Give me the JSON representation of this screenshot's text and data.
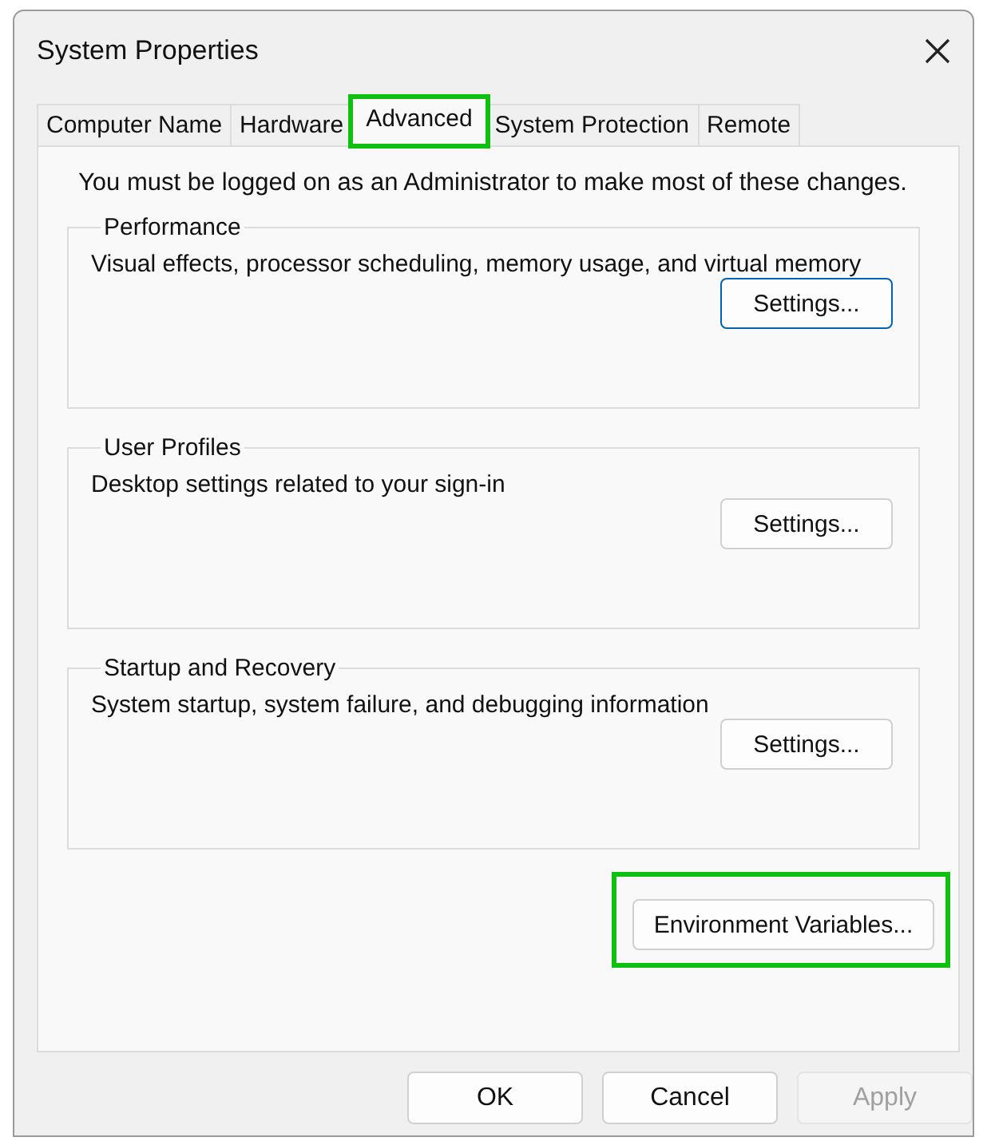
{
  "window": {
    "title": "System Properties"
  },
  "tabs": [
    {
      "label": "Computer Name",
      "selected": false,
      "highlighted": false
    },
    {
      "label": "Hardware",
      "selected": false,
      "highlighted": false
    },
    {
      "label": "Advanced",
      "selected": true,
      "highlighted": true
    },
    {
      "label": "System Protection",
      "selected": false,
      "highlighted": false
    },
    {
      "label": "Remote",
      "selected": false,
      "highlighted": false
    }
  ],
  "notice": "You must be logged on as an Administrator to make most of these changes.",
  "groups": [
    {
      "title": "Performance",
      "description": "Visual effects, processor scheduling, memory usage, and virtual memory",
      "button": "Settings...",
      "focused": true
    },
    {
      "title": "User Profiles",
      "description": "Desktop settings related to your sign-in",
      "button": "Settings...",
      "focused": false
    },
    {
      "title": "Startup and Recovery",
      "description": "System startup, system failure, and debugging information",
      "button": "Settings...",
      "focused": false
    }
  ],
  "environment_button": {
    "label": "Environment Variables...",
    "highlighted": true
  },
  "buttons": [
    {
      "label": "OK",
      "disabled": false
    },
    {
      "label": "Cancel",
      "disabled": false
    },
    {
      "label": "Apply",
      "disabled": true
    }
  ]
}
